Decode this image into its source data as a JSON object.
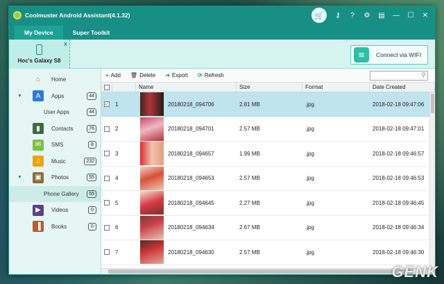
{
  "app": {
    "title": "Coolmuster Android Assistant(4.1.32)"
  },
  "tabs": [
    {
      "label": "My Device"
    },
    {
      "label": "Super Toolkit"
    }
  ],
  "device": {
    "name": "Hoc's Galaxy S8",
    "close": "x"
  },
  "wifi": {
    "label": "Connect via WIFI"
  },
  "sidebar": {
    "items": [
      {
        "label": "Home",
        "icon": "home-icon",
        "count": ""
      },
      {
        "label": "Apps",
        "icon": "apps-icon",
        "count": "44"
      },
      {
        "label": "User Apps",
        "icon": "",
        "count": "44"
      },
      {
        "label": "Contacts",
        "icon": "contacts-icon",
        "count": "76"
      },
      {
        "label": "SMS",
        "icon": "sms-icon",
        "count": "8"
      },
      {
        "label": "Music",
        "icon": "music-icon",
        "count": "232"
      },
      {
        "label": "Photos",
        "icon": "photos-icon",
        "count": "55"
      },
      {
        "label": "Phone Gallery",
        "icon": "",
        "count": "55"
      },
      {
        "label": "Videos",
        "icon": "videos-icon",
        "count": "0"
      },
      {
        "label": "Books",
        "icon": "books-icon",
        "count": "0"
      }
    ]
  },
  "toolbar": {
    "add": "Add",
    "delete": "Delete",
    "export": "Export",
    "refresh": "Refresh",
    "search_placeholder": ""
  },
  "table": {
    "headers": {
      "name": "Name",
      "size": "Size",
      "format": "Format",
      "date": "Date Created"
    },
    "rows": [
      {
        "idx": "1",
        "name": "20180218_094706",
        "size": "2.81 MB",
        "format": ".jpg",
        "date": "2018-02-18 09:47:06",
        "selected": true
      },
      {
        "idx": "2",
        "name": "20180218_094701",
        "size": "2.57 MB",
        "format": ".jpg",
        "date": "2018-02-18 09:47:01",
        "selected": false
      },
      {
        "idx": "3",
        "name": "20180218_094657",
        "size": "1.99 MB",
        "format": ".jpg",
        "date": "2018-02-18 09:46:57",
        "selected": false
      },
      {
        "idx": "4",
        "name": "20180218_094653",
        "size": "2.57 MB",
        "format": ".jpg",
        "date": "2018-02-18 09:46:53",
        "selected": false
      },
      {
        "idx": "5",
        "name": "20180218_094645",
        "size": "2.27 MB",
        "format": ".jpg",
        "date": "2018-02-18 09:46:45",
        "selected": false
      },
      {
        "idx": "6",
        "name": "20180218_094634",
        "size": "2.67 MB",
        "format": ".jpg",
        "date": "2018-02-18 09:46:34",
        "selected": false
      },
      {
        "idx": "7",
        "name": "20180218_094630",
        "size": "2.57 MB",
        "format": ".jpg",
        "date": "2018-02-18 09:46:30",
        "selected": false
      }
    ]
  },
  "watermark": "GENK",
  "colors": {
    "accent": "#178f84",
    "sidebar": "#e5f6f5",
    "selected_row": "#bfe3ef"
  }
}
